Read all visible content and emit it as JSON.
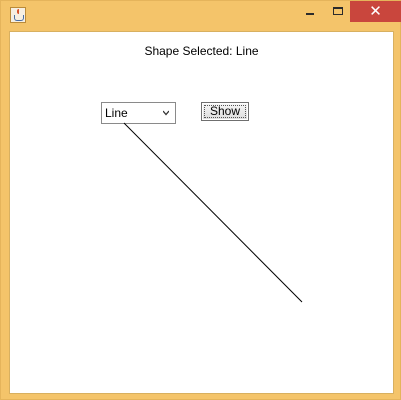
{
  "window": {
    "minimize_glyph": "",
    "maximize_glyph": "",
    "close_glyph": "✕",
    "icon": "java-app-icon"
  },
  "status": {
    "label": "Shape Selected: Line"
  },
  "shape_selector": {
    "selected": "Line"
  },
  "show_button": {
    "label": "Show"
  },
  "drawing": {
    "shape": "line"
  }
}
